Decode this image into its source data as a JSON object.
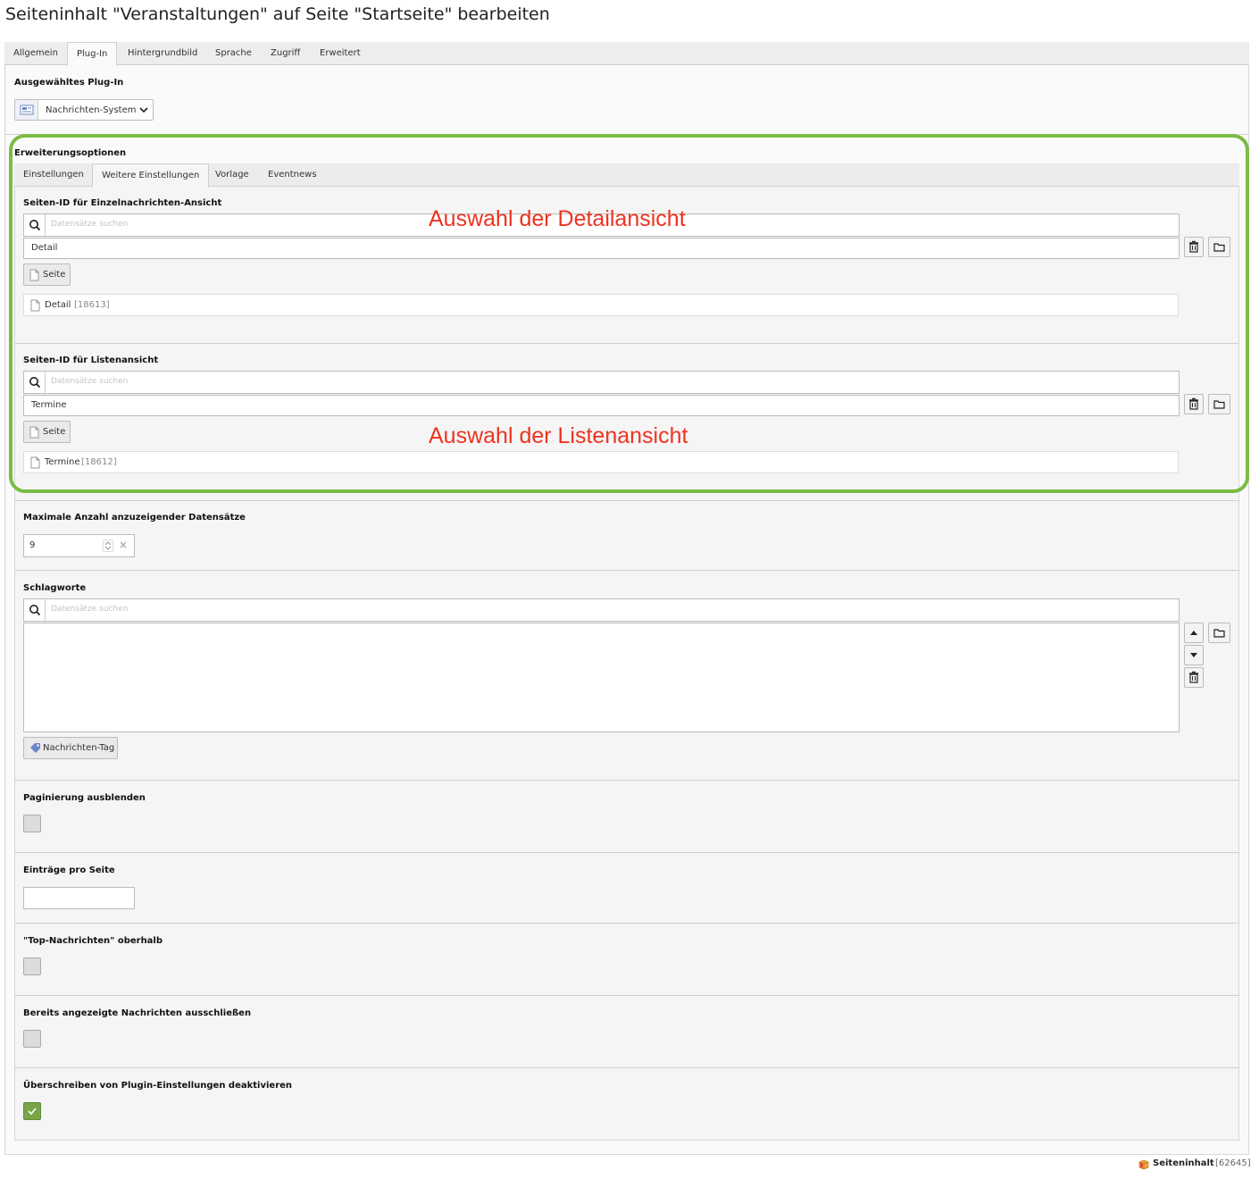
{
  "page": {
    "title": "Seiteninhalt \"Veranstaltungen\" auf Seite \"Startseite\" bearbeiten"
  },
  "tabs": [
    "Allgemein",
    "Plug-In",
    "Hintergrundbild",
    "Sprache",
    "Zugriff",
    "Erweitert"
  ],
  "plugin": {
    "label": "Ausgewähltes Plug-In",
    "selected": "Nachrichten-System"
  },
  "extension": {
    "label": "Erweiterungsoptionen",
    "tabs": [
      "Einstellungen",
      "Weitere Einstellungen",
      "Vorlage",
      "Eventnews"
    ]
  },
  "detail": {
    "label": "Seiten-ID für Einzelnachrichten-Ansicht",
    "search_placeholder": "Datensätze suchen",
    "value": "Detail",
    "button": "Seite",
    "record_title": "Detail",
    "record_uid": "[18613]",
    "annotation": "Auswahl der Detailansicht"
  },
  "list": {
    "label": "Seiten-ID für Listenansicht",
    "search_placeholder": "Datensätze suchen",
    "value": "Termine",
    "button": "Seite",
    "record_title": "Termine",
    "record_uid": "[18612]",
    "annotation": "Auswahl der Listenansicht"
  },
  "max_records": {
    "label": "Maximale Anzahl anzuzeigender Datensätze",
    "value": "9"
  },
  "tags": {
    "label": "Schlagworte",
    "search_placeholder": "Datensätze suchen",
    "button": "Nachrichten-Tag"
  },
  "hide_pagination": {
    "label": "Paginierung ausblenden",
    "checked": false
  },
  "items_per_page": {
    "label": "Einträge pro Seite",
    "value": ""
  },
  "top_news": {
    "label": "\"Top-Nachrichten\" oberhalb",
    "checked": false
  },
  "exclude_displayed": {
    "label": "Bereits angezeigte Nachrichten ausschließen",
    "checked": false
  },
  "disable_override": {
    "label": "Überschreiben von Plugin-Einstellungen deaktivieren",
    "checked": true
  },
  "footer": {
    "record_type": "Seiteninhalt",
    "record_uid": "[62645]"
  },
  "colors": {
    "accent_green": "#7bbc45",
    "annotation_red": "#ee3320",
    "checkbox_checked": "#79a548"
  }
}
